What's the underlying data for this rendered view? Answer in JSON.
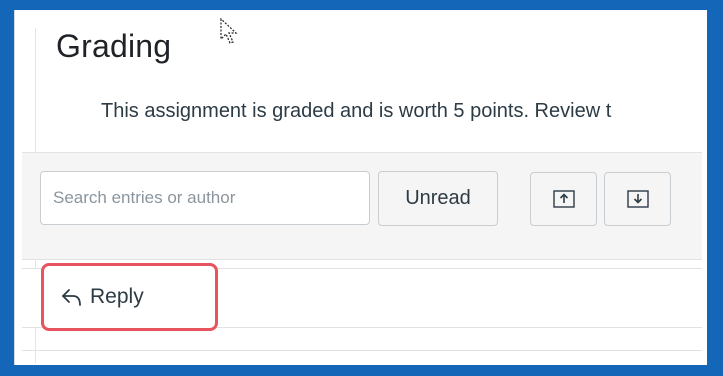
{
  "page": {
    "title": "Grading",
    "description": "This assignment is graded and is worth 5 points.  Review t"
  },
  "toolbar": {
    "search_placeholder": "Search entries or author",
    "unread_label": "Unread",
    "expand_icon": "arrow-up-in-box-icon",
    "collapse_icon": "arrow-down-in-box-icon"
  },
  "reply": {
    "label": "Reply",
    "icon": "reply-arrow-icon",
    "highlight_color": "#e8545e"
  },
  "colors": {
    "frame_border": "#1466b8"
  }
}
